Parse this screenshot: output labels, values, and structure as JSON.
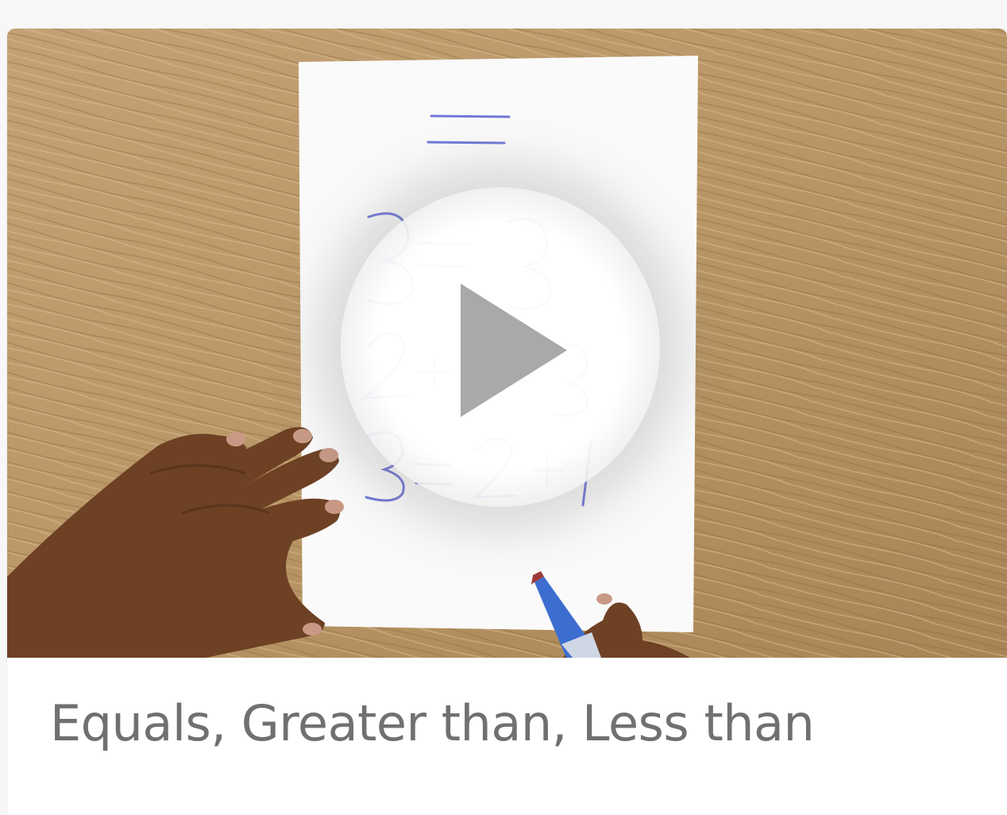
{
  "video": {
    "title": "Equals, Greater than, Less than",
    "play_icon": "play-icon",
    "paper_lines": [
      "=",
      "3 = 3",
      "2 + 1 = 3",
      "3 = 2 + 1"
    ]
  },
  "colors": {
    "page_background": "#f7f7f8",
    "caption_text": "#707070",
    "marker_ink": "#4a52c8",
    "play_triangle": "#a9a9a9"
  }
}
